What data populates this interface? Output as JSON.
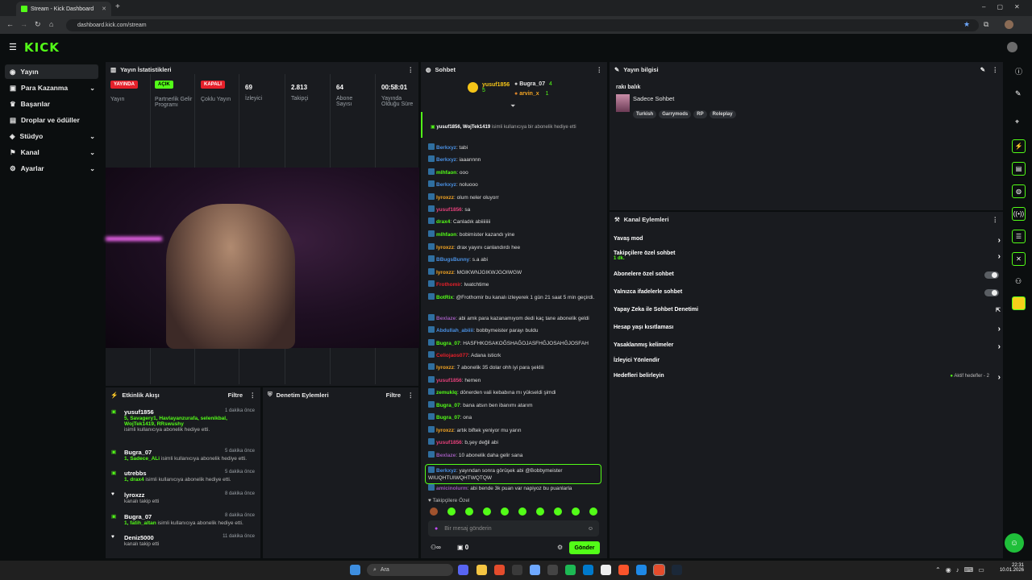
{
  "browser": {
    "tab_title": "Stream - Kick Dashboard",
    "url": "dashboard.kick.com/stream"
  },
  "app": {
    "logo": "KICK"
  },
  "sidebar": {
    "items": [
      {
        "label": "Yayın"
      },
      {
        "label": "Para Kazanma"
      },
      {
        "label": "Başarılar"
      },
      {
        "label": "Droplar ve ödüller"
      },
      {
        "label": "Stüdyo"
      },
      {
        "label": "Kanal"
      },
      {
        "label": "Ayarlar"
      }
    ]
  },
  "stats": {
    "title": "Yayın İstatistikleri",
    "items": [
      {
        "badge": "YAYINDA",
        "badge_color": "#e5202a",
        "label": "Yayın"
      },
      {
        "badge": "AÇIK",
        "badge_color": "#53fc18",
        "label": "Partnerlik Gelir Programı"
      },
      {
        "badge": "KAPALI",
        "badge_color": "#e5202a",
        "label": "Çoklu Yayın"
      },
      {
        "value": "69",
        "label": "İzleyici"
      },
      {
        "value": "2.813",
        "label": "Takipçi"
      },
      {
        "value": "64",
        "label": "Abone Sayısı"
      },
      {
        "value": "00:58:01",
        "label": "Yayında Olduğu Süre"
      }
    ]
  },
  "activity": {
    "title": "Etkinlik Akışı",
    "filter": "Filtre",
    "items": [
      {
        "name": "yusuf1856",
        "time": "1 dakika önce",
        "green": "5, Savagery1, Havlayanzurafa, selenikbal, WojTek1419, RRswushy",
        "desc": "isimli kullanıcıya abonelik hediye etti."
      },
      {
        "name": "Bugra_07",
        "time": "5 dakika önce",
        "green": "1, Sadece_ALi",
        "desc": "isimli kullanıcıya abonelik hediye etti."
      },
      {
        "name": "utrebbs",
        "time": "5 dakika önce",
        "green": "1, drax4",
        "desc": "isimli kullanıcıya abonelik hediye etti."
      },
      {
        "name": "lyroxzz",
        "time": "8 dakika önce",
        "green": "",
        "desc": "kanalı takip etti"
      },
      {
        "name": "Bugra_07",
        "time": "8 dakika önce",
        "green": "1, fatih_altan",
        "desc": "isimli kullanıcıya abonelik hediye etti."
      },
      {
        "name": "Deniz5000",
        "time": "11 dakika önce",
        "green": "",
        "desc": "kanalı takip etti"
      }
    ]
  },
  "moderation": {
    "title": "Denetim Eylemleri",
    "filter": "Filtre"
  },
  "chat": {
    "title": "Sohbet",
    "top": [
      {
        "name": "yusuf1856",
        "count": "5"
      },
      {
        "name": "Bugra_07",
        "count": "4"
      },
      {
        "name": "arvin_x",
        "count": "1"
      }
    ],
    "gift_banner": {
      "users": "yusuf1856, WojTek1419",
      "text": "isimli kullanıcıya bir abonelik hediye etti"
    },
    "messages": [
      {
        "user": "Berkxyz",
        "color": "#4a90e2",
        "text": ": tabi"
      },
      {
        "user": "Berkxyz",
        "color": "#4a90e2",
        "text": ": iaaannnn"
      },
      {
        "user": "mlhfaon",
        "color": "#53fc18",
        "text": ": ooo"
      },
      {
        "user": "Berkxyz",
        "color": "#4a90e2",
        "text": ": noluooo"
      },
      {
        "user": "lyroxzz",
        "color": "#f5a623",
        "text": ": olum neler oluyorr"
      },
      {
        "user": "yusuf1856",
        "color": "#e5407a",
        "text": ": sa"
      },
      {
        "user": "drax4",
        "color": "#53fc18",
        "text": ": Canladık abiiiiiiii"
      },
      {
        "user": "mlhfaon",
        "color": "#53fc18",
        "text": ": bobimister kazandı yine"
      },
      {
        "user": "lyroxzz",
        "color": "#f5a623",
        "text": ": drax yayını canlandırdı hee"
      },
      {
        "user": "BBugsBunny",
        "color": "#4a90e2",
        "text": ": s.a abi"
      },
      {
        "user": "lyroxzz",
        "color": "#f5a623",
        "text": ": MGIKWNJGIKWJGOIWGW"
      },
      {
        "user": "Frothomir",
        "color": "#e5202a",
        "text": ": Iwatchtime"
      },
      {
        "user": "BotRix",
        "color": "#53fc18",
        "text": ": @Frothomir bu kanalı izleyerek 1 gün 21 saat 5 min geçirdi."
      },
      {
        "user": "Bexlaze",
        "color": "#9b59b6",
        "text": ": abi amk para kazanamıyom dedi kaç tane abonelik geldi"
      },
      {
        "user": "Abdullah_abiiii",
        "color": "#4a90e2",
        "text": ": bobbymeister parayı buldu"
      },
      {
        "user": "Bugra_07",
        "color": "#53fc18",
        "text": ": HASFHKOSAKOĞSHAĞOJASFHĞJOSAHĞJOSFAH"
      },
      {
        "user": "Celiojaos077",
        "color": "#e5202a",
        "text": ": Adana isticrk"
      },
      {
        "user": "lyroxzz",
        "color": "#f5a623",
        "text": ": 7 abonelik 35 dolar ohh iyi para şekliii"
      },
      {
        "user": "yusuf1856",
        "color": "#e5407a",
        "text": ": hemen"
      },
      {
        "user": "zemuklq",
        "color": "#53fc18",
        "text": ": dönerden vali kebabına mı yükseldi şimdi"
      },
      {
        "user": "Bugra_07",
        "color": "#53fc18",
        "text": ": bana atsın ben ibanımı atarım"
      },
      {
        "user": "Bugra_07",
        "color": "#53fc18",
        "text": ": ona"
      },
      {
        "user": "lyroxzz",
        "color": "#f5a623",
        "text": ": artık biftek yeniyor mu yarın"
      },
      {
        "user": "yusuf1856",
        "color": "#e5407a",
        "text": ": b,şey değil abi"
      },
      {
        "user": "Bexlaze",
        "color": "#9b59b6",
        "text": ": 10 abonelik daha gelir sana"
      },
      {
        "user": "Berkxyz",
        "color": "#4a90e2",
        "text": ": yayından sonra görüşek abi @Bobbymeister WIUQHTUIWQHTWQTQW"
      },
      {
        "user": "amicinolurm",
        "color": "#9b59b6",
        "text": ": abi bende 3k puan var napiyoz bu puanlarla"
      }
    ],
    "followers_only": "Takipçilere Özel",
    "input_placeholder": "Bir mesaj gönderin",
    "points": "0",
    "send": "Gönder"
  },
  "stream_info": {
    "title": "Yayın bilgisi",
    "stream_title": "rakı balık",
    "category": "Sadece Sohbet",
    "tags": [
      "Turkish",
      "Garrymods",
      "RP",
      "Roleplay"
    ]
  },
  "channel_actions": {
    "title": "Kanal Eylemleri",
    "rows": [
      {
        "label": "Yavaş mod",
        "sub": "",
        "right": "chevron"
      },
      {
        "label": "Takipçilere özel sohbet",
        "sub": "1 dk.",
        "right": "chevron"
      },
      {
        "label": "Abonelere özel sohbet",
        "sub": "",
        "right": "toggle"
      },
      {
        "label": "Yalnızca ifadelerle sohbet",
        "sub": "",
        "right": "toggle"
      },
      {
        "label": "Yapay Zeka ile Sohbet Denetimi",
        "sub": "",
        "right": "external"
      },
      {
        "label": "Hesap yaşı kısıtlaması",
        "sub": "",
        "right": "chevron"
      },
      {
        "label": "Yasaklanmış kelimeler",
        "sub": "",
        "right": "chevron"
      },
      {
        "label": "İzleyici Yönlendir",
        "sub": "",
        "right": "none"
      },
      {
        "label": "Hedefleri belirleyin",
        "sub": "",
        "right": "chevron",
        "status": "Aktif hedefler - 2"
      }
    ]
  },
  "taskbar": {
    "search": "Ara",
    "time": "22:31",
    "date": "10.01.2026"
  }
}
